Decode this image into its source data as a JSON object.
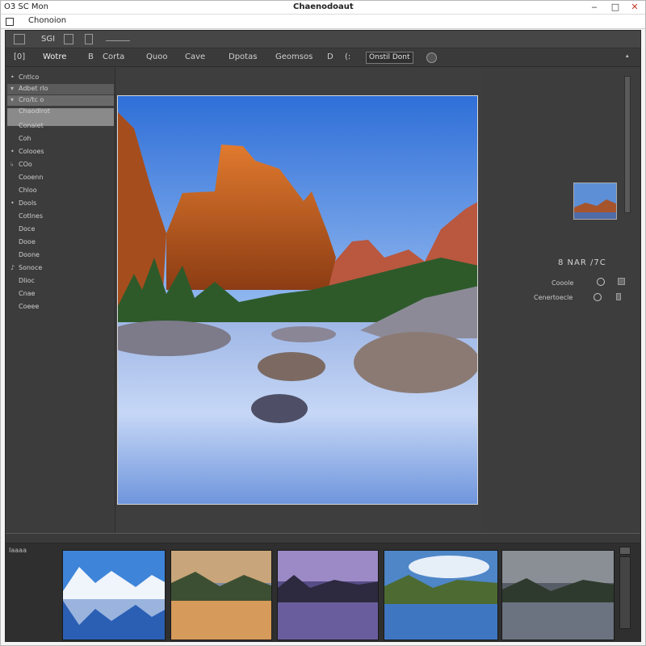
{
  "titlebar": {
    "app_title": "O3 SC Mon",
    "document_title": "Chaenodoaut",
    "minimize": "‒",
    "maximize": "□",
    "close": "✕"
  },
  "menubar": {
    "icon": "app-icon",
    "item": "Chonoion"
  },
  "toolbar1": {
    "label": "SGI"
  },
  "toolbar2": {
    "items": [
      "[0]",
      "Wotre",
      "B",
      "Corta",
      "Quoo",
      "Cave",
      "Dpotas",
      "Geomsos",
      "D",
      "(:"
    ],
    "box_label": "Onstil Dont"
  },
  "left_panel": {
    "rows": [
      {
        "glyph": "•",
        "label": "Cntlco"
      },
      {
        "glyph": "▾",
        "label": "Adbet rlo"
      },
      {
        "glyph": "▾",
        "label": "Cro/tc o"
      },
      {
        "glyph": "",
        "label": "Chaodlrot"
      },
      {
        "glyph": "",
        "label": "Conaiet"
      },
      {
        "glyph": "",
        "label": "Coh"
      },
      {
        "glyph": "•",
        "label": "Colooes"
      },
      {
        "glyph": "♭",
        "label": "COo"
      },
      {
        "glyph": "",
        "label": "Cooenn"
      },
      {
        "glyph": "",
        "label": "Chloo"
      },
      {
        "glyph": "•",
        "label": "Dools"
      },
      {
        "glyph": "",
        "label": "Cotlnes"
      },
      {
        "glyph": "",
        "label": "Doce"
      },
      {
        "glyph": "",
        "label": "Dooe"
      },
      {
        "glyph": "",
        "label": "Doone"
      },
      {
        "glyph": "♪",
        "label": "Sonoce"
      },
      {
        "glyph": "",
        "label": "Dlioc"
      },
      {
        "glyph": "",
        "label": "Cnae"
      },
      {
        "glyph": "",
        "label": "Coeee"
      }
    ]
  },
  "right_panel": {
    "heading": "8 NAR /7C",
    "row1": "Cooole",
    "row2": "Cenertoecle"
  },
  "filmstrip": {
    "label": "Iaaaa",
    "count": 5
  },
  "colors": {
    "panel_bg": "#3e3e3e",
    "toolbar_bg": "#464646",
    "filmstrip_bg": "#2f2f2f",
    "accent_window_close": "#c0392b"
  }
}
